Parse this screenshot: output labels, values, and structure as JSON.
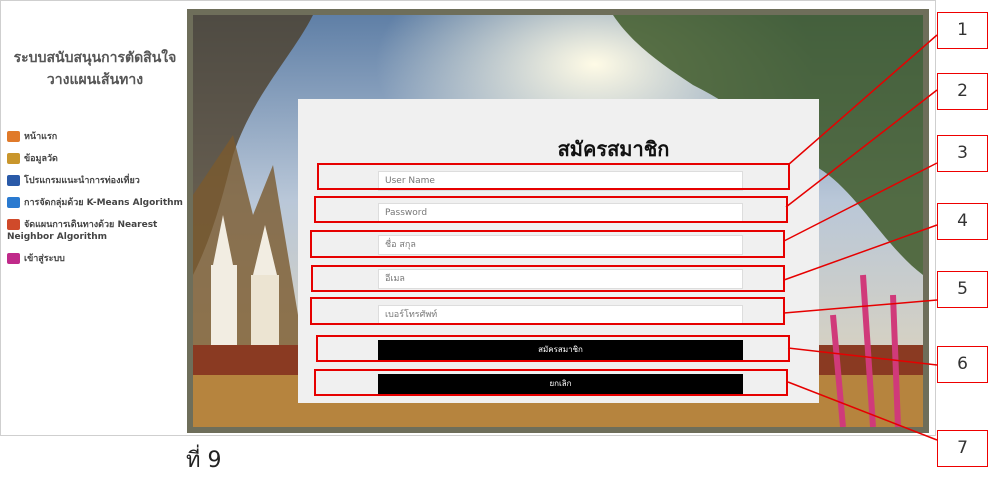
{
  "sidebar": {
    "title_line1": "ระบบสนับสนุนการตัดสินใจ",
    "title_line2": "วางแผนเส้นทาง",
    "items": [
      {
        "label": "หน้าแรก",
        "icon": "home-icon",
        "color": "#e07a2a"
      },
      {
        "label": "ข้อมูลวัด",
        "icon": "temple-icon",
        "color": "#c9962c"
      },
      {
        "label": "โปรแกรมแนะนำการท่องเที่ยว",
        "icon": "program-icon",
        "color": "#2a5aa8"
      },
      {
        "label": "การจัดกลุ่มด้วย K-Means Algorithm",
        "icon": "cluster-icon",
        "color": "#2a7ad0"
      },
      {
        "label": "จัดแผนการเดินทางด้วย Nearest Neighbor Algorithm",
        "icon": "route-icon",
        "color": "#d04a2a"
      },
      {
        "label": "เข้าสู่ระบบ",
        "icon": "login-icon",
        "color": "#c02a8a"
      }
    ]
  },
  "form": {
    "title": "สมัครสมาชิก",
    "username_placeholder": "User Name",
    "password_placeholder": "Password",
    "fullname_placeholder": "ชื่อ สกุล",
    "email_placeholder": "อีเมล",
    "phone_placeholder": "เบอร์โทรศัพท์",
    "register_label": "สมัครสมาชิก",
    "cancel_label": "ยกเลิก"
  },
  "callouts": [
    "1",
    "2",
    "3",
    "4",
    "5",
    "6",
    "7"
  ],
  "caption": "ที่ 9",
  "colors": {
    "highlight": "#e60000",
    "button": "#000000",
    "form_bg": "#f0f0f0"
  }
}
